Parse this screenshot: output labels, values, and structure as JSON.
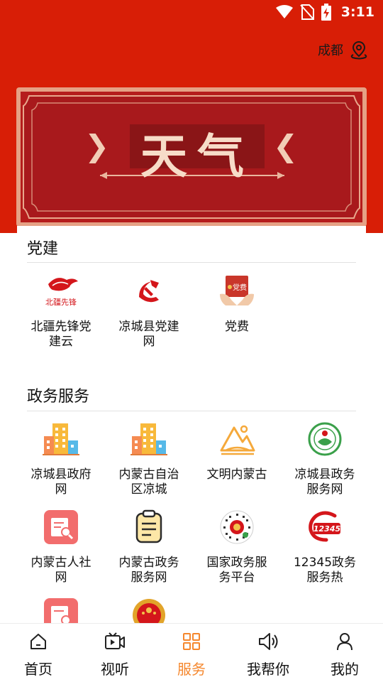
{
  "status_bar": {
    "time": "3:11"
  },
  "location": {
    "city": "成都"
  },
  "banner": {
    "title": "天气",
    "left_mark": "❯",
    "right_mark": "❮"
  },
  "sections": [
    {
      "title": "党建",
      "items": [
        {
          "label": "北疆先锋党建云",
          "icon": "beijiang-xianfeng-logo-icon",
          "logo_text": "北疆先锋"
        },
        {
          "label": "凉城县党建网",
          "icon": "party-emblem-icon"
        },
        {
          "label": "党费",
          "icon": "party-fee-icon",
          "logo_text": "党费"
        }
      ]
    },
    {
      "title": "政务服务",
      "items": [
        {
          "label": "凉城县政府网",
          "icon": "buildings-icon"
        },
        {
          "label": "内蒙古自治区凉城",
          "icon": "buildings-icon"
        },
        {
          "label": "文明内蒙古",
          "icon": "mountain-icon"
        },
        {
          "label": "凉城县政务服务网",
          "icon": "green-seal-icon"
        },
        {
          "label": "内蒙古人社网",
          "icon": "document-search-icon"
        },
        {
          "label": "内蒙古政务服务网",
          "icon": "clipboard-icon"
        },
        {
          "label": "国家政务服务平台",
          "icon": "qr-code-icon"
        },
        {
          "label": "12345政务服务热",
          "icon": "hotline-12345-icon",
          "logo_text": "12345"
        },
        {
          "label": "",
          "icon": "document-search-icon"
        },
        {
          "label": "",
          "icon": "national-emblem-icon"
        }
      ]
    }
  ],
  "tabbar": {
    "active_index": 2,
    "active_color": "#f5872d",
    "items": [
      {
        "label": "首页",
        "icon": "home-icon"
      },
      {
        "label": "视听",
        "icon": "video-icon"
      },
      {
        "label": "服务",
        "icon": "grid-icon"
      },
      {
        "label": "我帮你",
        "icon": "speaker-icon"
      },
      {
        "label": "我的",
        "icon": "user-icon"
      }
    ]
  },
  "colors": {
    "header_red": "#d81e06",
    "banner_red": "#b51c1c",
    "accent_orange": "#f5872d"
  }
}
